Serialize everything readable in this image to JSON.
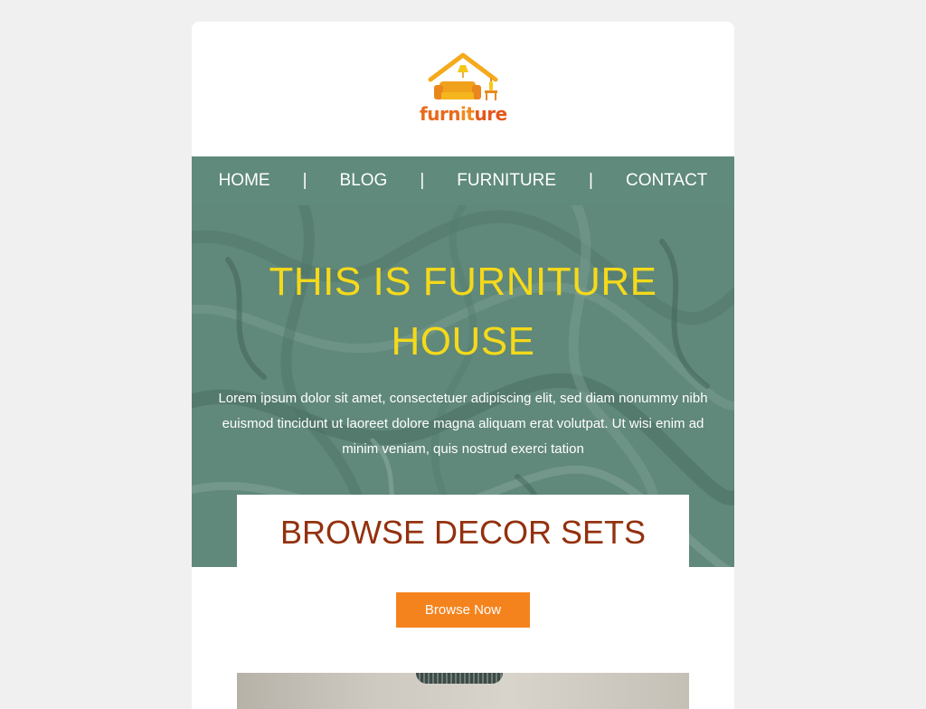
{
  "brand": {
    "logo_text_part1": "furn",
    "logo_text_part2": "it",
    "logo_text_part3": "ure",
    "colors": {
      "orange": "#f5831d",
      "dark_orange": "#e96a1c",
      "yellow": "#f5c71a"
    }
  },
  "nav": {
    "items": [
      {
        "label": "HOME"
      },
      {
        "label": "BLOG"
      },
      {
        "label": "FURNITURE"
      },
      {
        "label": "CONTACT"
      }
    ],
    "separator": "|",
    "background": "#5f8a7c"
  },
  "hero": {
    "title_line1": "THIS IS FURNITURE",
    "title_line2": "HOUSE",
    "title_color": "#f5d91a",
    "body": "Lorem ipsum dolor sit amet, consectetuer adipiscing elit, sed diam nonummy nibh euismod tincidunt ut laoreet dolore magna aliquam erat volutpat. Ut wisi enim ad minim veniam, quis nostrud exerci tation"
  },
  "decor": {
    "title": "BROWSE DECOR SETS",
    "title_color": "#93310e"
  },
  "cta": {
    "label": "Browse Now",
    "background": "#f5831d"
  }
}
